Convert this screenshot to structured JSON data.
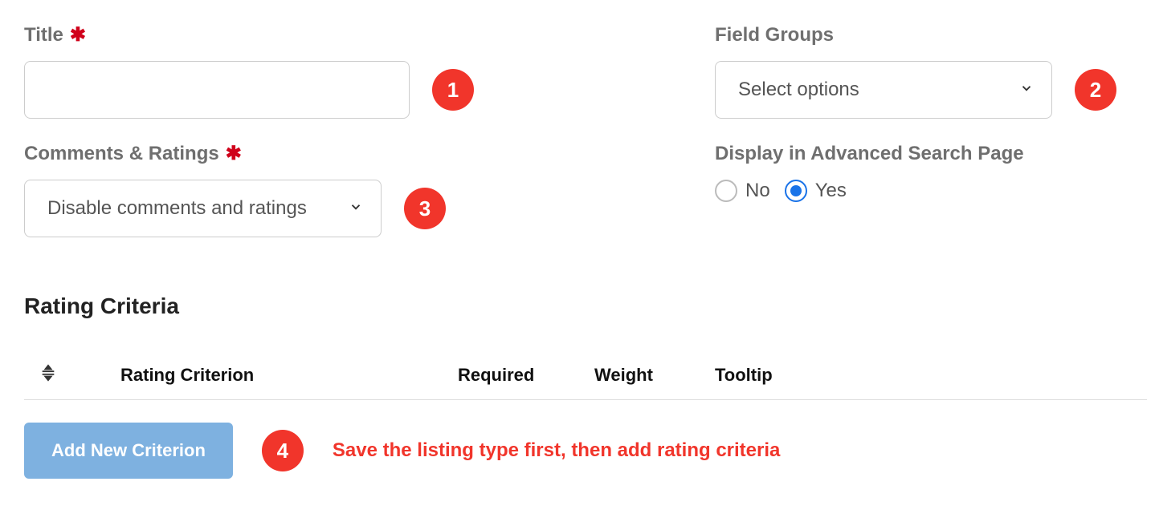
{
  "fields": {
    "title": {
      "label": "Title",
      "value": "",
      "required": true,
      "badge": "1"
    },
    "field_groups": {
      "label": "Field Groups",
      "selected": "Select options",
      "badge": "2"
    },
    "comments_ratings": {
      "label": "Comments & Ratings",
      "selected": "Disable comments and ratings",
      "required": true,
      "badge": "3"
    },
    "display_search": {
      "label": "Display in Advanced Search Page",
      "options": {
        "no": "No",
        "yes": "Yes"
      },
      "value": "yes"
    }
  },
  "rating": {
    "section_title": "Rating Criteria",
    "columns": {
      "criterion": "Rating Criterion",
      "required": "Required",
      "weight": "Weight",
      "tooltip": "Tooltip"
    },
    "add_button": "Add New Criterion",
    "badge": "4",
    "help": "Save the listing type first, then add rating criteria"
  }
}
